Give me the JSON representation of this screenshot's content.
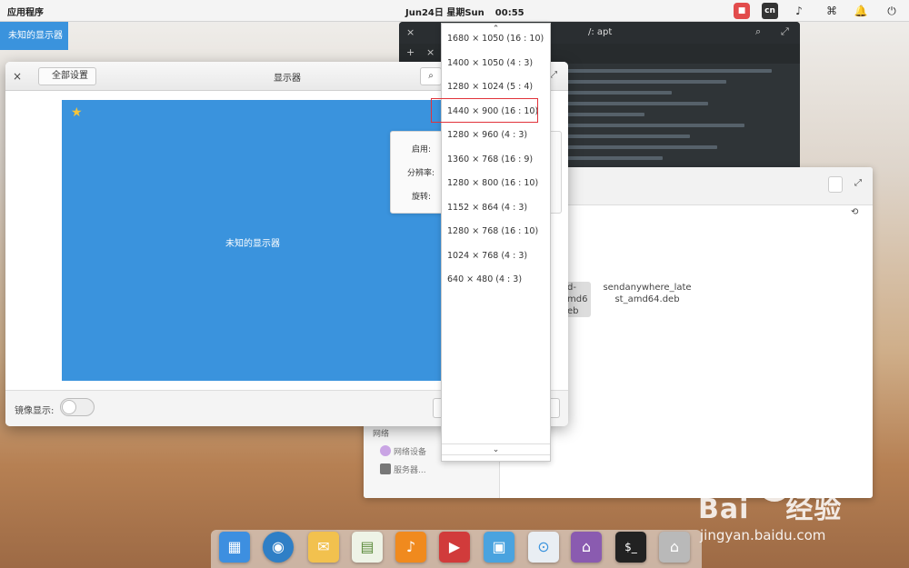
{
  "topbar": {
    "apps_label": "应用程序",
    "date": "Jun24日 星期Sun",
    "time": "00:55",
    "tray_cn": "cn"
  },
  "active_window_tag": "未知的显示器",
  "terminal": {
    "title": "/: apt"
  },
  "files": {
    "network_section": "网络",
    "network_devices": "网络设备",
    "servers": "服务器...",
    "file_name_line1": "sendanywhere_late",
    "file_name_line2": "st_amd64.deb",
    "file_cut_line1": "d-",
    "file_cut_line2": "md6",
    "file_cut_line3": "eb"
  },
  "display_window": {
    "back_label": "全部设置",
    "title": "显示器",
    "monitor_label": "未知的显示器",
    "enable_label": "启用:",
    "resolution_label": "分辨率:",
    "rotation_label": "旋转:",
    "mirror_label": "镜像显示:",
    "mirror_on": false
  },
  "resolution_dropdown": {
    "options": [
      "1680 × 1050 (16 : 10)",
      "1400 × 1050 (4 : 3)",
      "1280 × 1024 (5 : 4)",
      "1440 × 900 (16 : 10)",
      "1280 × 960 (4 : 3)",
      "1360 × 768 (16 : 9)",
      "1280 × 800 (16 : 10)",
      "1152 × 864 (4 : 3)",
      "1280 × 768 (16 : 10)",
      "1024 × 768 (4 : 3)",
      "640 × 480 (4 : 3)"
    ],
    "highlighted": "1440 × 900 (16 : 10)"
  },
  "dock": {
    "icons": [
      "multitasking-icon",
      "browser-icon",
      "mail-icon",
      "calendar-icon",
      "music-icon",
      "video-icon",
      "photos-icon",
      "settings-icon",
      "appcenter-icon",
      "terminal-icon",
      "files-icon"
    ]
  },
  "watermark": {
    "brand_left": "Bai",
    "brand_right": "经验",
    "url": "jingyan.baidu.com"
  },
  "colors": {
    "accent": "#3a93dd",
    "highlight_border": "#e1333a",
    "terminal_bg": "#2f3437"
  }
}
